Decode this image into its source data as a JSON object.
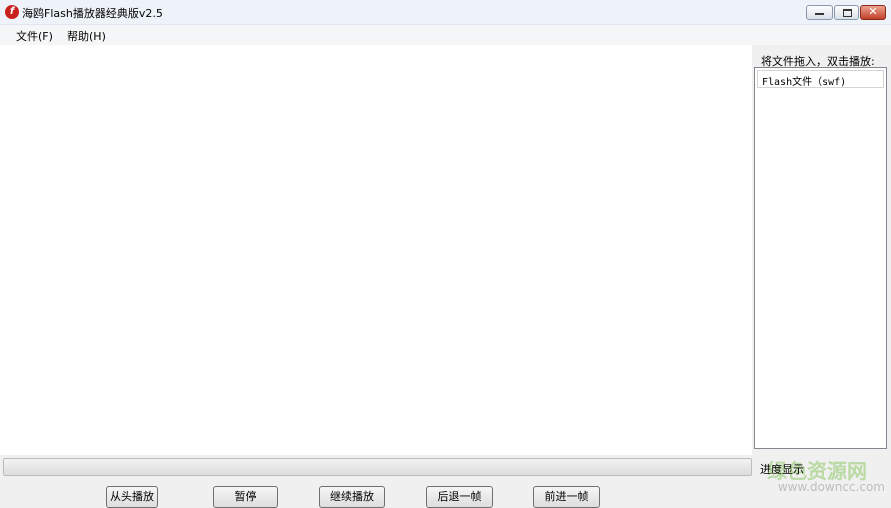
{
  "window": {
    "title": "海鸥Flash播放器经典版v2.5",
    "app_icon": "flash-icon",
    "close_glyph": "✕"
  },
  "menu": [
    {
      "label": "文件(F)"
    },
    {
      "label": "帮助(H)"
    }
  ],
  "sidebar": {
    "hint": "将文件拖入，双击播放:",
    "list_header": "Flash文件（swf)"
  },
  "progress": {
    "label": "进度显示",
    "value": 0
  },
  "controls": [
    {
      "label": "从头播放"
    },
    {
      "label": "暂停"
    },
    {
      "label": "继续播放"
    },
    {
      "label": "后退一帧"
    },
    {
      "label": "前进一帧"
    }
  ],
  "watermark": {
    "main": "绿色资源网",
    "url": "www.downcc.com"
  },
  "colors": {
    "close_button": "#c2412a",
    "app_icon": "#c9211e",
    "watermark": "#78be46"
  }
}
